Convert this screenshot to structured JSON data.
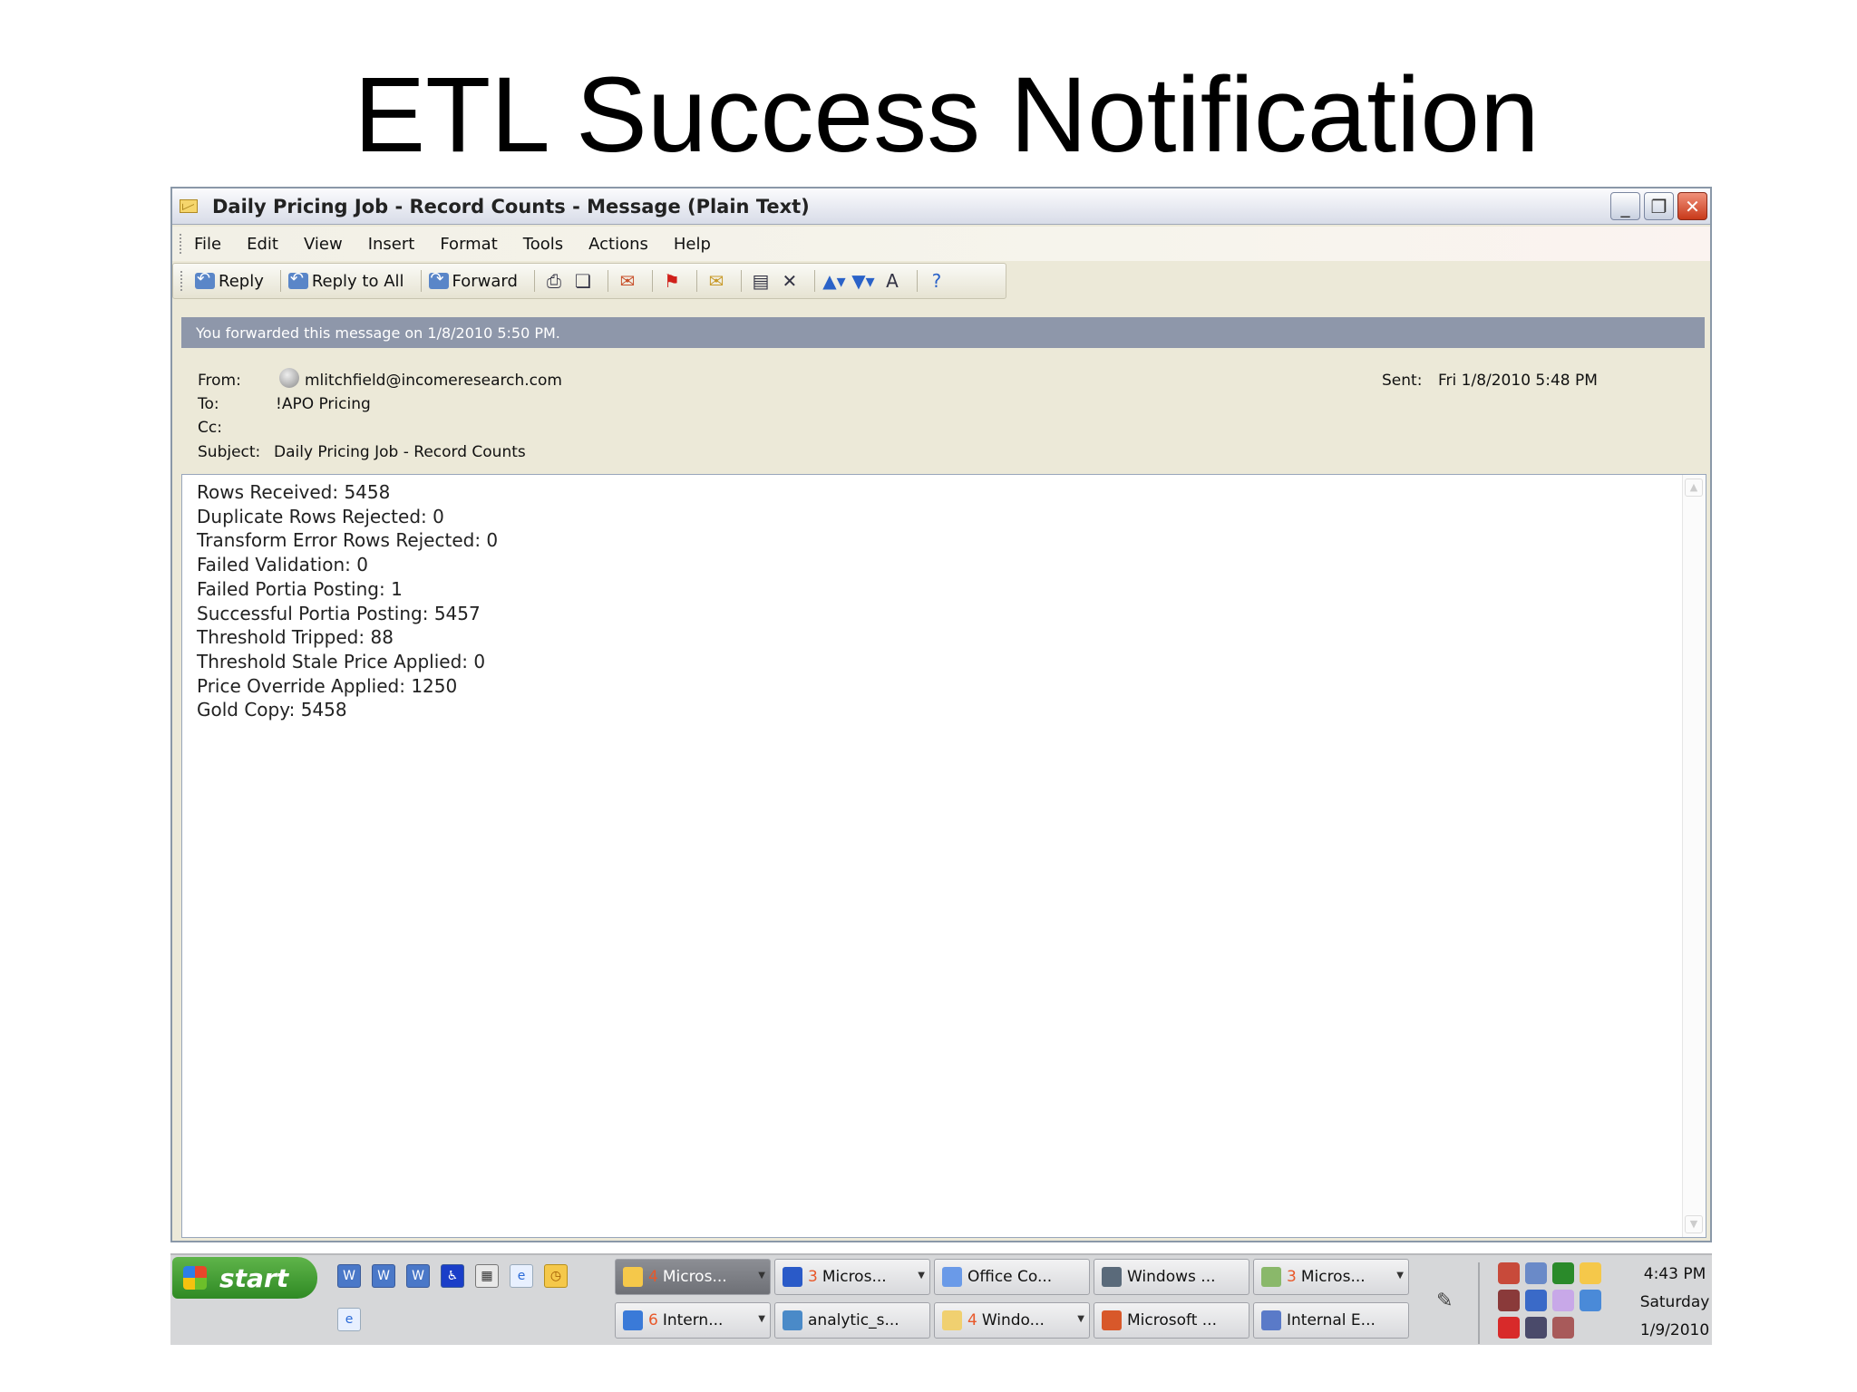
{
  "slide": {
    "title": "ETL Success Notification"
  },
  "window": {
    "title": "Daily Pricing Job - Record Counts - Message (Plain Text)",
    "menu": [
      "File",
      "Edit",
      "View",
      "Insert",
      "Format",
      "Tools",
      "Actions",
      "Help"
    ],
    "toolbar": {
      "reply": "Reply",
      "reply_all": "Reply to All",
      "forward": "Forward",
      "icons": [
        "print-icon",
        "copy-icon",
        "delete-mail-icon",
        "flag-icon",
        "open-envelope-icon",
        "move-to-folder-icon",
        "delete-icon",
        "previous-item-icon",
        "next-item-icon",
        "font-size-icon",
        "help-icon"
      ]
    },
    "info_bar": "You forwarded this message on 1/8/2010 5:50 PM.",
    "header": {
      "from_label": "From:",
      "from": "mlitchfield@incomeresearch.com",
      "to_label": "To:",
      "to": "!APO Pricing",
      "cc_label": "Cc:",
      "subject_label": "Subject:",
      "subject": "Daily Pricing Job - Record Counts",
      "sent_label": "Sent:",
      "sent": "Fri 1/8/2010 5:48 PM"
    },
    "body": [
      "Rows Received: 5458",
      "Duplicate Rows Rejected: 0",
      "Transform Error Rows Rejected: 0",
      "Failed Validation: 0",
      "Failed Portia Posting: 1",
      "Successful Portia Posting: 5457",
      "Threshold Tripped: 88",
      "Threshold Stale Price Applied: 0",
      "Price Override Applied: 1250",
      "Gold Copy: 5458"
    ]
  },
  "taskbar": {
    "start": "start",
    "tasks_row1": [
      {
        "count": "4",
        "label": "Micros...",
        "icon": "outlook-icon",
        "active": true,
        "arrow": true
      },
      {
        "count": "3",
        "label": "Micros...",
        "icon": "word-icon",
        "active": false,
        "arrow": true
      },
      {
        "count": "",
        "label": "Office Co...",
        "icon": "office-clipboard-icon",
        "active": false,
        "arrow": false
      },
      {
        "count": "",
        "label": "Windows ...",
        "icon": "windows-app-icon",
        "active": false,
        "arrow": false
      },
      {
        "count": "3",
        "label": "Micros...",
        "icon": "project-icon",
        "active": false,
        "arrow": true
      }
    ],
    "tasks_row2": [
      {
        "count": "6",
        "label": "Intern...",
        "icon": "ie-icon",
        "active": false,
        "arrow": true
      },
      {
        "count": "",
        "label": "analytic_s...",
        "icon": "sql-icon",
        "active": false,
        "arrow": false
      },
      {
        "count": "4",
        "label": "Windo...",
        "icon": "folder-icon",
        "active": false,
        "arrow": true
      },
      {
        "count": "",
        "label": "Microsoft ...",
        "icon": "powerpoint-icon",
        "active": false,
        "arrow": false
      },
      {
        "count": "",
        "label": "Internal E...",
        "icon": "app-icon",
        "active": false,
        "arrow": false
      }
    ],
    "clock": {
      "time": "4:43 PM",
      "day": "Saturday",
      "date": "1/9/2010"
    },
    "colors": {
      "start_green": "#3a9a2c",
      "taskbar": "#d6d7d9",
      "info_bar": "#8e97aa"
    }
  }
}
